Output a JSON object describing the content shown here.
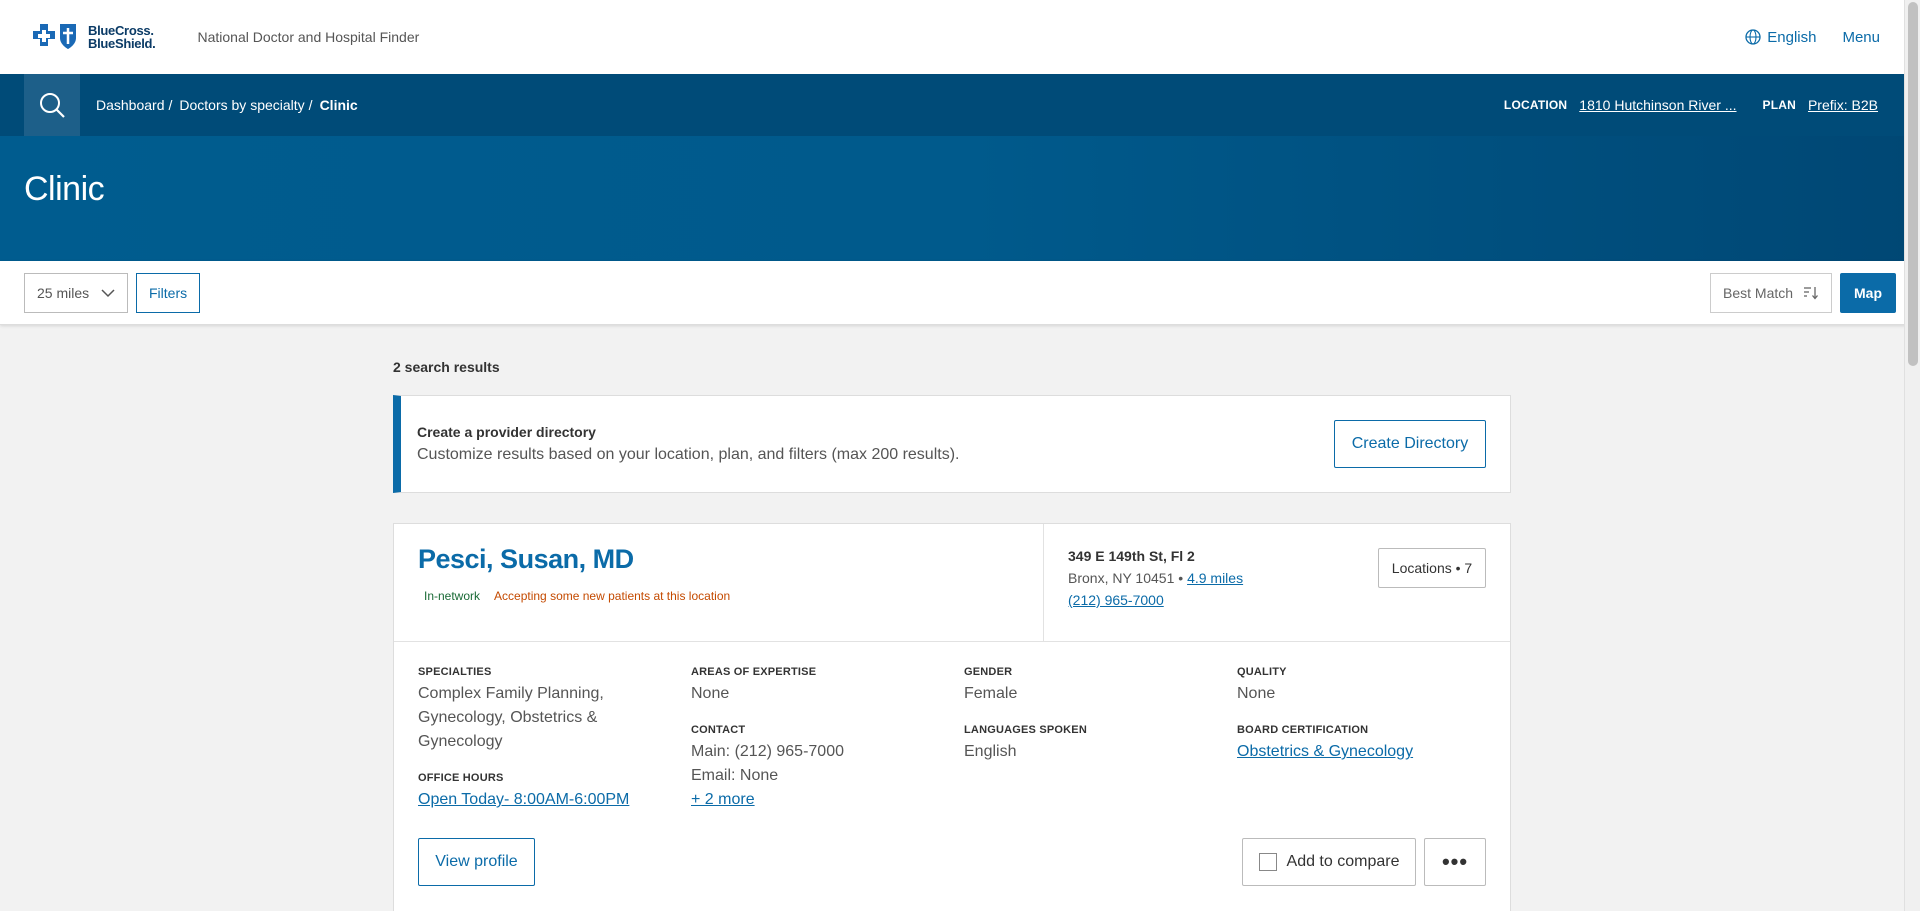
{
  "header": {
    "logo_line1": "BlueCross.",
    "logo_line2": "BlueShield.",
    "app_title": "National Doctor and Hospital Finder",
    "language": "English",
    "menu": "Menu"
  },
  "nav": {
    "breadcrumbs": [
      "Dashboard",
      "Doctors by specialty",
      "Clinic"
    ],
    "separator": "/",
    "location_label": "LOCATION",
    "location_value": "1810 Hutchinson River ...",
    "plan_label": "PLAN",
    "plan_value": "Prefix: B2B"
  },
  "hero": {
    "title": "Clinic"
  },
  "filterbar": {
    "distance": "25 miles",
    "filters": "Filters",
    "sort": "Best Match",
    "map": "Map"
  },
  "results": {
    "count_text": "2 search results"
  },
  "directory": {
    "title": "Create a provider directory",
    "desc": "Customize results based on your location, plan, and filters (max 200 results).",
    "button": "Create Directory"
  },
  "provider": {
    "name": "Pesci, Susan, MD",
    "badge_network": "In-network",
    "badge_accepting": "Accepting some new patients at this location",
    "street": "349 E 149th St, Fl 2",
    "city": "Bronx, NY 10451",
    "bullet": "•",
    "distance": "4.9 miles",
    "phone": "(212) 965-7000",
    "locations_btn": "Locations • 7",
    "specialties_label": "SPECIALTIES",
    "specialties_value": "Complex Family Planning, Gynecology,  Obstetrics & Gynecology",
    "office_hours_label": "OFFICE HOURS",
    "office_hours_value": "Open Today- 8:00AM-6:00PM",
    "expertise_label": "AREAS OF EXPERTISE",
    "expertise_value": "None",
    "contact_label": "CONTACT",
    "contact_main": "Main: (212) 965-7000",
    "contact_email": "Email: None",
    "contact_more": "+ 2 more",
    "gender_label": "GENDER",
    "gender_value": "Female",
    "languages_label": "LANGUAGES SPOKEN",
    "languages_value": "English",
    "quality_label": "QUALITY",
    "quality_value": "None",
    "board_label": "BOARD CERTIFICATION",
    "board_value": "Obstetrics & Gynecology",
    "view_profile": "View profile",
    "add_compare": "Add to compare",
    "more": "•••"
  },
  "colors": {
    "brand": "#0b6ba8",
    "navbar": "#004b78",
    "accepting": "#c44a00",
    "network": "#1a6a36"
  }
}
